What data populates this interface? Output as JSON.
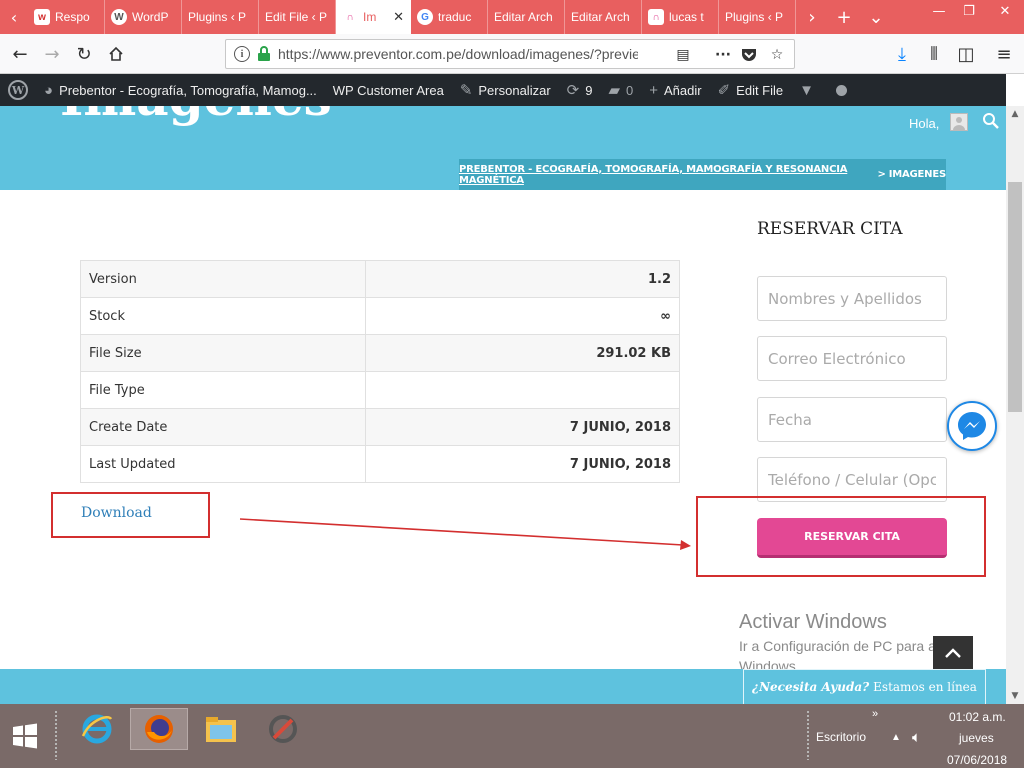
{
  "browser": {
    "tabs": [
      {
        "label": "Respo",
        "favicon": "w",
        "favicon_bg": "#ffffff",
        "favicon_color": "#d32f2f"
      },
      {
        "label": "WordP",
        "favicon": "W",
        "favicon_bg": "#ffffff",
        "favicon_color": "#555555"
      },
      {
        "label": "Plugins ‹ P",
        "favicon": "",
        "favicon_bg": "",
        "favicon_color": ""
      },
      {
        "label": "Edit File ‹ P",
        "favicon": "",
        "favicon_bg": "",
        "favicon_color": ""
      },
      {
        "label": "Im",
        "favicon": "∩",
        "favicon_bg": "#ffffff",
        "favicon_color": "#e34894",
        "active": true
      },
      {
        "label": "traduc",
        "favicon": "G",
        "favicon_bg": "#ffffff",
        "favicon_color": "#4285f4"
      },
      {
        "label": "Editar Arch",
        "favicon": "",
        "favicon_bg": "",
        "favicon_color": ""
      },
      {
        "label": "Editar Arch",
        "favicon": "",
        "favicon_bg": "",
        "favicon_color": ""
      },
      {
        "label": "lucas t",
        "favicon": "∩",
        "favicon_bg": "#ffffff",
        "favicon_color": "#e34894"
      },
      {
        "label": "Plugins ‹ P",
        "favicon": "",
        "favicon_bg": "",
        "favicon_color": ""
      }
    ],
    "url": "https://www.preventor.com.pe/download/imagenes/?previe"
  },
  "adminbar": {
    "site_name": "Prebentor - Ecografía, Tomografía, Mamog...",
    "customer_area": "WP Customer Area",
    "customize": "Personalizar",
    "updates_count": "9",
    "comments_count": "0",
    "add_new": "Añadir",
    "edit_file": "Edit File"
  },
  "header": {
    "title": "Imagenes",
    "greeting": "Hola,",
    "breadcrumb_home": "PREBENTOR - ECOGRAFÍA, TOMOGRAFÍA, MAMOGRAFÍA Y RESONANCIA MAGNÉTICA",
    "breadcrumb_sep": ">",
    "breadcrumb_current": "IMAGENES"
  },
  "file_info": {
    "rows": [
      {
        "label": "Version",
        "value": "1.2"
      },
      {
        "label": "Stock",
        "value": "∞"
      },
      {
        "label": "File Size",
        "value": "291.02 KB"
      },
      {
        "label": "File Type",
        "value": ""
      },
      {
        "label": "Create Date",
        "value": "7 JUNIO, 2018"
      },
      {
        "label": "Last Updated",
        "value": "7 JUNIO, 2018"
      }
    ],
    "download_label": "Download"
  },
  "sidebar": {
    "title": "RESERVAR CITA",
    "fields": [
      {
        "placeholder": "Nombres y Apellidos"
      },
      {
        "placeholder": "Correo Electrónico"
      },
      {
        "placeholder": "Fecha"
      },
      {
        "placeholder": "Teléfono / Celular (Opc"
      }
    ],
    "submit_label": "RESERVAR CITA"
  },
  "watermark": {
    "line1": "Activar Windows",
    "line2": "Ir a Configuración de PC para activar Windows."
  },
  "help_widget": {
    "bold": "¿Necesita Ayuda?",
    "text": "Estamos en línea"
  },
  "taskbar": {
    "desktop_label": "Escritorio",
    "time": "01:02 a.m.",
    "day": "jueves",
    "date": "07/06/2018"
  },
  "colors": {
    "tab_accent": "#e85f5f",
    "hero": "#5ec2de",
    "button": "#e34894",
    "annotation": "#d32f2f"
  }
}
